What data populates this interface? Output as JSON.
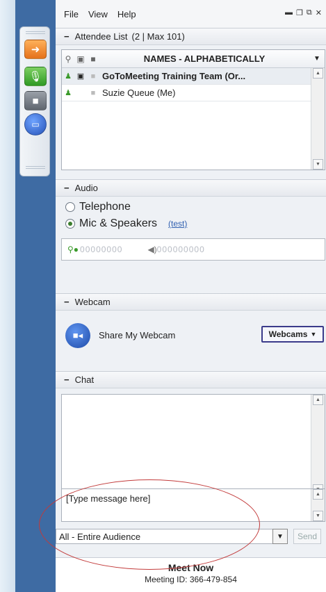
{
  "menu": [
    "File",
    "View",
    "Help"
  ],
  "attendee": {
    "title": "Attendee List",
    "count": "(2 | Max 101)",
    "names_header": "NAMES - ALPHABETICALLY",
    "rows": [
      {
        "name": "GoToMeeting Training Team (Or...",
        "bold": true
      },
      {
        "name": "Suzie Queue (Me)",
        "bold": false
      }
    ]
  },
  "audio": {
    "title": "Audio",
    "telephone": "Telephone",
    "mic": "Mic & Speakers",
    "test": "(test)"
  },
  "webcam": {
    "title": "Webcam",
    "share": "Share My Webcam",
    "button": "Webcams"
  },
  "chat": {
    "title": "Chat",
    "placeholder": "[Type message here]",
    "audience": "All - Entire Audience",
    "send": "Send"
  },
  "meet": {
    "title": "Meet Now",
    "id": "Meeting ID: 366-479-854"
  }
}
